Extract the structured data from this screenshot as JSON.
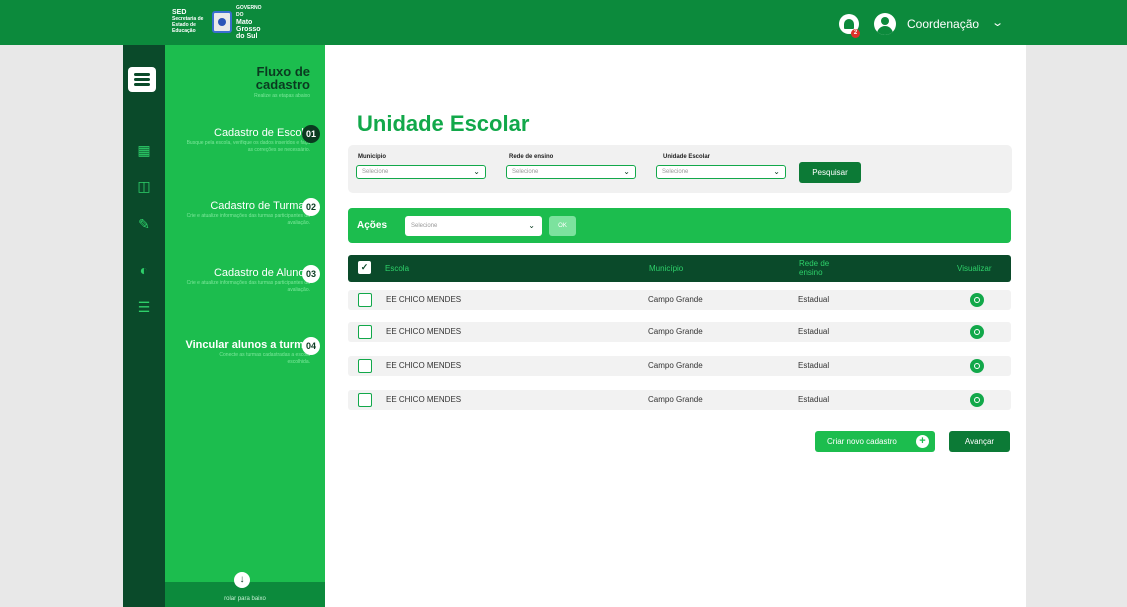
{
  "header": {
    "logo": {
      "sed_title": "SED",
      "sed_sub": "Secretaria de Estado de Educação",
      "gov_small": "GOVERNO DO",
      "gov_name": "Mato Grosso do Sul"
    },
    "notification_count": "2",
    "user_name": "Coordenação",
    "accent": "#0c8a3c"
  },
  "rail": {
    "icons": [
      "building-icon",
      "desk-icon",
      "classroom-icon",
      "chart-icon",
      "network-icon"
    ]
  },
  "flow": {
    "title": "Fluxo de cadastro",
    "subtitle": "Realize as etapas abaixo",
    "steps": [
      {
        "num": "01",
        "title": "Cadastro de Escola",
        "desc": "Busque pela escola, verifique os dados inseridos e faça as correções se necessário."
      },
      {
        "num": "02",
        "title": "Cadastro de Turmas",
        "desc": "Crie e atualize informações das turmas participantes da avaliação."
      },
      {
        "num": "03",
        "title": "Cadastro de Alunos",
        "desc": "Crie e atualize informações das turmas participantes da avaliação."
      },
      {
        "num": "04",
        "title": "Vincular alunos a turma",
        "desc": "Conecte as turmas cadastradas a escola escolhida."
      }
    ],
    "scroll_label": "rolar para baixo"
  },
  "main": {
    "title": "Unidade Escolar",
    "filters": [
      {
        "label": "Município",
        "placeholder": "Selecione"
      },
      {
        "label": "Rede de ensino",
        "placeholder": "Selecione"
      },
      {
        "label": "Unidade Escolar",
        "placeholder": "Selecione"
      }
    ],
    "search_label": "Pesquisar",
    "actions": {
      "label": "Ações",
      "placeholder": "Selecione",
      "ok_label": "OK"
    },
    "table": {
      "headers": [
        "Escola",
        "Município",
        "Rede de ensino",
        "Visualizar"
      ],
      "rows": [
        {
          "escola": "EE CHICO MENDES",
          "municipio": "Campo Grande",
          "rede": "Estadual"
        },
        {
          "escola": "EE CHICO MENDES",
          "municipio": "Campo Grande",
          "rede": "Estadual"
        },
        {
          "escola": "EE CHICO MENDES",
          "municipio": "Campo Grande",
          "rede": "Estadual"
        },
        {
          "escola": "EE CHICO MENDES",
          "municipio": "Campo Grande",
          "rede": "Estadual"
        }
      ]
    },
    "create_label": "Criar novo cadastro",
    "next_label": "Avançar"
  }
}
